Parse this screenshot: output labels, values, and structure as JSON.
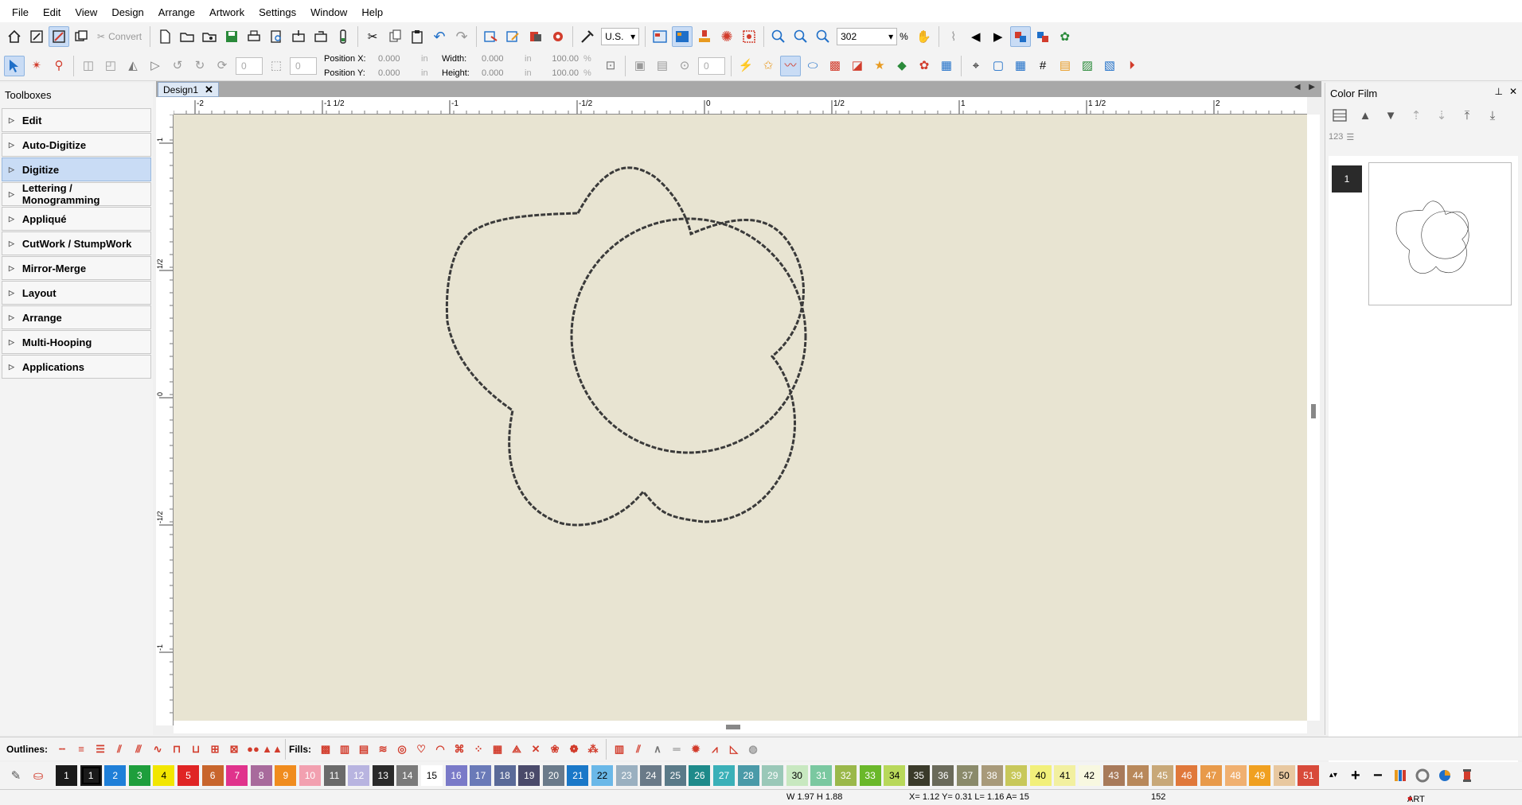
{
  "menu": [
    "File",
    "Edit",
    "View",
    "Design",
    "Arrange",
    "Artwork",
    "Settings",
    "Window",
    "Help"
  ],
  "toolbar1": {
    "convert_label": "Convert",
    "units": "U.S.",
    "zoom": "302",
    "zoom_unit": "%"
  },
  "toolbar2": {
    "rotate_value": "0",
    "skew_value": "0",
    "pos_x_label": "Position X:",
    "pos_x": "0.000",
    "pos_y_label": "Position Y:",
    "pos_y": "0.000",
    "width_label": "Width:",
    "width": "0.000",
    "height_label": "Height:",
    "height": "0.000",
    "unit": "in",
    "scale_w": "100.00",
    "scale_h": "100.00",
    "scale_unit": "%",
    "spin3": "0"
  },
  "toolboxes": {
    "title": "Toolboxes",
    "items": [
      "Edit",
      "Auto-Digitize",
      "Digitize",
      "Lettering / Monogramming",
      "Appliqué",
      "CutWork / StumpWork",
      "Mirror-Merge",
      "Layout",
      "Arrange",
      "Multi-Hooping",
      "Applications"
    ],
    "selected": "Digitize"
  },
  "document": {
    "tab_title": "Design1"
  },
  "rulers": {
    "horizontal": [
      "-2",
      "-1 1/2",
      "-1",
      "-1/2",
      "0",
      "1/2",
      "1",
      "1 1/2",
      "2"
    ],
    "vertical": [
      "1",
      "1/2",
      "0",
      "-1/2",
      "-1"
    ]
  },
  "color_film": {
    "title": "Color Film",
    "sequence_label": "123",
    "entries": [
      "1"
    ]
  },
  "bottom_toolbar": {
    "outlines_label": "Outlines:",
    "fills_label": "Fills:"
  },
  "palette": {
    "swatches": [
      {
        "n": "1",
        "c": "#1a1a1a",
        "t": "#ffffff"
      },
      {
        "n": "1",
        "c": "#1a1a1a",
        "t": "#ffffff"
      },
      {
        "n": "2",
        "c": "#1f7fd8",
        "t": "#ffffff"
      },
      {
        "n": "3",
        "c": "#1e9e3c",
        "t": "#ffffff"
      },
      {
        "n": "4",
        "c": "#f2e600",
        "t": "#000000"
      },
      {
        "n": "5",
        "c": "#e02424",
        "t": "#ffffff"
      },
      {
        "n": "6",
        "c": "#c8652c",
        "t": "#ffffff"
      },
      {
        "n": "7",
        "c": "#e0338c",
        "t": "#ffffff"
      },
      {
        "n": "8",
        "c": "#a86a9c",
        "t": "#ffffff"
      },
      {
        "n": "9",
        "c": "#f08c1e",
        "t": "#ffffff"
      },
      {
        "n": "10",
        "c": "#f2a0b0",
        "t": "#ffffff"
      },
      {
        "n": "11",
        "c": "#6a6a6a",
        "t": "#ffffff"
      },
      {
        "n": "12",
        "c": "#b8b4e0",
        "t": "#ffffff"
      },
      {
        "n": "13",
        "c": "#2a2a2a",
        "t": "#ffffff"
      },
      {
        "n": "14",
        "c": "#7a7a7a",
        "t": "#ffffff"
      },
      {
        "n": "15",
        "c": "#ffffff",
        "t": "#000000"
      },
      {
        "n": "16",
        "c": "#7a7ac8",
        "t": "#ffffff"
      },
      {
        "n": "17",
        "c": "#6a7ab8",
        "t": "#ffffff"
      },
      {
        "n": "18",
        "c": "#5a6a98",
        "t": "#ffffff"
      },
      {
        "n": "19",
        "c": "#4a4a6a",
        "t": "#ffffff"
      },
      {
        "n": "20",
        "c": "#6a7a8a",
        "t": "#ffffff"
      },
      {
        "n": "21",
        "c": "#1a78c8",
        "t": "#ffffff"
      },
      {
        "n": "22",
        "c": "#6ab8e8",
        "t": "#000000"
      },
      {
        "n": "23",
        "c": "#9ab0c0",
        "t": "#ffffff"
      },
      {
        "n": "24",
        "c": "#6a7a88",
        "t": "#ffffff"
      },
      {
        "n": "25",
        "c": "#5a7a88",
        "t": "#ffffff"
      },
      {
        "n": "26",
        "c": "#1e8a8a",
        "t": "#ffffff"
      },
      {
        "n": "27",
        "c": "#3ab0b8",
        "t": "#ffffff"
      },
      {
        "n": "28",
        "c": "#4a9aa8",
        "t": "#ffffff"
      },
      {
        "n": "29",
        "c": "#9ac8b8",
        "t": "#ffffff"
      },
      {
        "n": "30",
        "c": "#c8e8c0",
        "t": "#000000"
      },
      {
        "n": "31",
        "c": "#7ac8a0",
        "t": "#ffffff"
      },
      {
        "n": "32",
        "c": "#9ab84a",
        "t": "#ffffff"
      },
      {
        "n": "33",
        "c": "#6ab82a",
        "t": "#ffffff"
      },
      {
        "n": "34",
        "c": "#b8d85a",
        "t": "#000000"
      },
      {
        "n": "35",
        "c": "#3a3a2a",
        "t": "#ffffff"
      },
      {
        "n": "36",
        "c": "#6a6a5a",
        "t": "#ffffff"
      },
      {
        "n": "37",
        "c": "#8a8a6a",
        "t": "#ffffff"
      },
      {
        "n": "38",
        "c": "#a89a7a",
        "t": "#ffffff"
      },
      {
        "n": "39",
        "c": "#c8c85a",
        "t": "#ffffff"
      },
      {
        "n": "40",
        "c": "#f2f07a",
        "t": "#000000"
      },
      {
        "n": "41",
        "c": "#f2f0a0",
        "t": "#000000"
      },
      {
        "n": "42",
        "c": "#f8f8e0",
        "t": "#000000"
      },
      {
        "n": "43",
        "c": "#a87a5a",
        "t": "#ffffff"
      },
      {
        "n": "44",
        "c": "#b8885a",
        "t": "#ffffff"
      },
      {
        "n": "45",
        "c": "#c8a878",
        "t": "#ffffff"
      },
      {
        "n": "46",
        "c": "#e0783a",
        "t": "#ffffff"
      },
      {
        "n": "47",
        "c": "#e89a4a",
        "t": "#ffffff"
      },
      {
        "n": "48",
        "c": "#f0b070",
        "t": "#ffffff"
      },
      {
        "n": "49",
        "c": "#f0a020",
        "t": "#ffffff"
      },
      {
        "n": "50",
        "c": "#e8c8a0",
        "t": "#000000"
      },
      {
        "n": "51",
        "c": "#d84a3a",
        "t": "#ffffff"
      }
    ]
  },
  "status": {
    "size": "W 1.97 H 1.88",
    "coords": "X= 1.12 Y= 0.31 L= 1.16 A=  15",
    "stitches": "152",
    "art_grade": "ART Grade: A"
  },
  "colors": {
    "canvas": "#e8e4d2",
    "stitch": "#3a3a3a",
    "selection": "#c9dcf5",
    "accent_red": "#d23c2c"
  }
}
